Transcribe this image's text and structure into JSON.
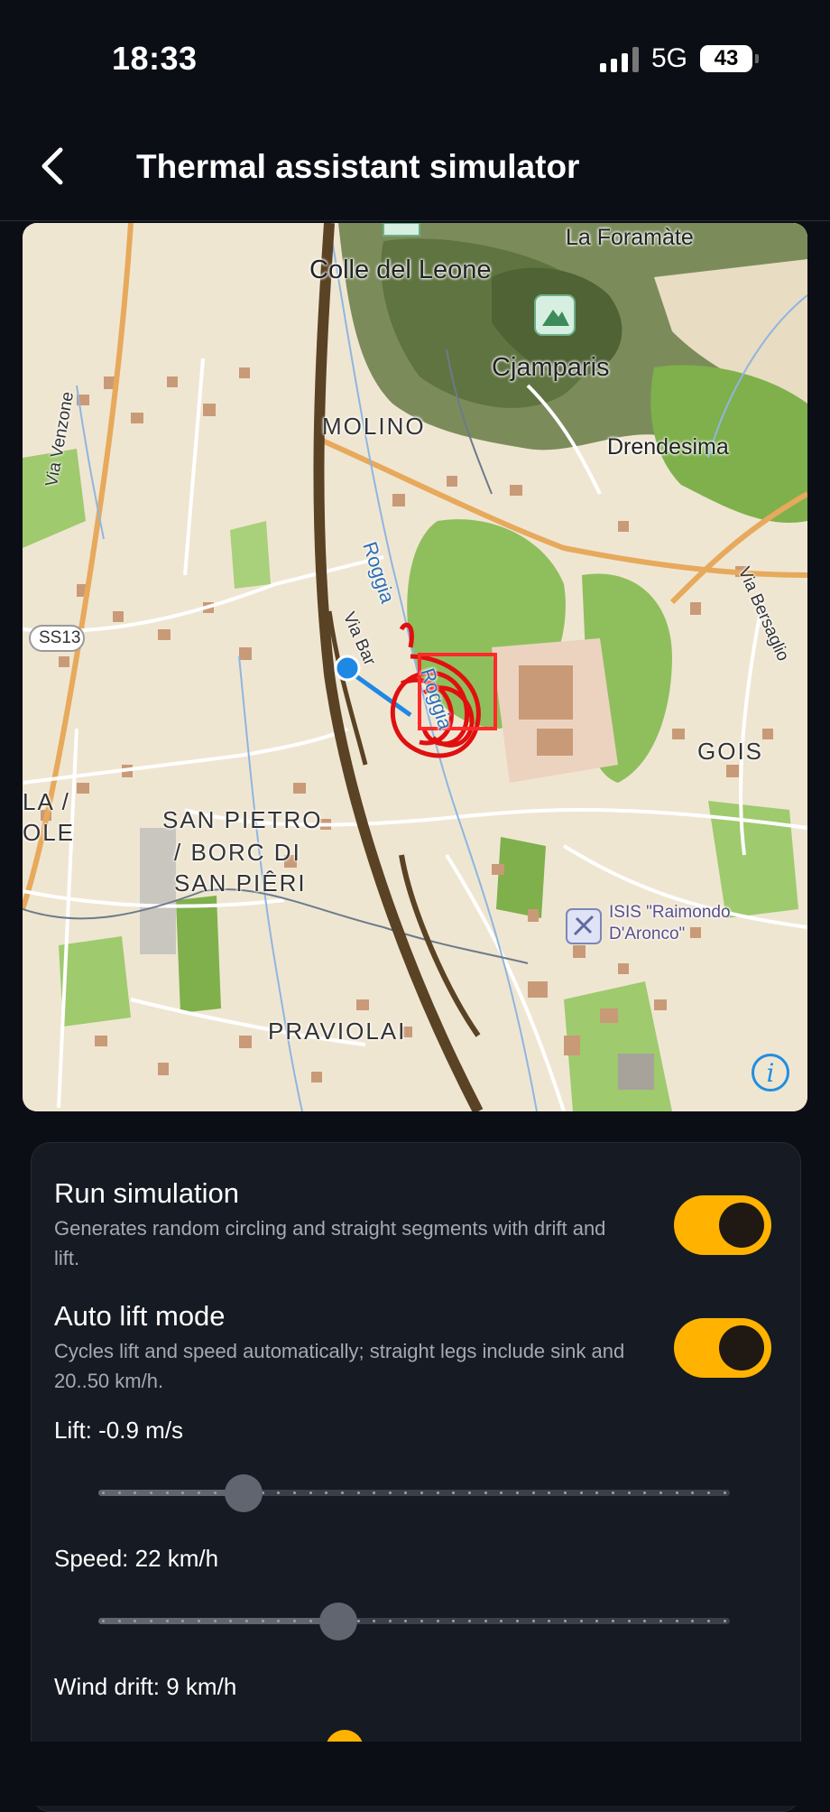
{
  "status": {
    "time": "18:33",
    "network": "5G",
    "battery": "43"
  },
  "header": {
    "title": "Thermal assistant simulator"
  },
  "map": {
    "labels": {
      "foramate": "La Foramàte",
      "colle": "Colle del Leone",
      "cjamparis": "Cjamparis",
      "molino": "MOLINO",
      "drendesima": "Drendesima",
      "via_venzone": "Via Venzone",
      "via_bersaglio": "Via Bersaglio",
      "ss13": "SS13",
      "roggia1": "Roggia",
      "roggia2": "Roggia",
      "via_bar": "Via Bar",
      "gois": "GOIS",
      "la_cut": "LA /",
      "ole_cut": "OLE",
      "san_pietro1": "SAN PIETRO",
      "san_pietro2": "/ BORC DI",
      "san_pietro3": "SAN PIÊRI",
      "isis1": "ISIS \"Raimondo",
      "isis2": "D'Aronco\"",
      "praviolai": "PRAVIOLAI"
    },
    "info_icon": "info-icon",
    "colors": {
      "track": "#e01010",
      "position": "#1e88e5",
      "railway": "#5a4224"
    }
  },
  "settings": {
    "run_simulation": {
      "title": "Run simulation",
      "description": "Generates random circling and straight segments with drift and lift.",
      "enabled": true
    },
    "auto_lift": {
      "title": "Auto lift mode",
      "description": "Cycles lift and speed automatically; straight legs include sink and 20..50 km/h.",
      "enabled": true
    },
    "lift": {
      "label": "Lift: -0.9 m/s",
      "fraction": 0.23
    },
    "speed": {
      "label": "Speed: 22 km/h",
      "fraction": 0.38
    },
    "wind": {
      "label": "Wind drift: 9 km/h"
    }
  },
  "colors": {
    "accent": "#ffb300",
    "background": "#0b0e15",
    "card": "#161a22"
  }
}
